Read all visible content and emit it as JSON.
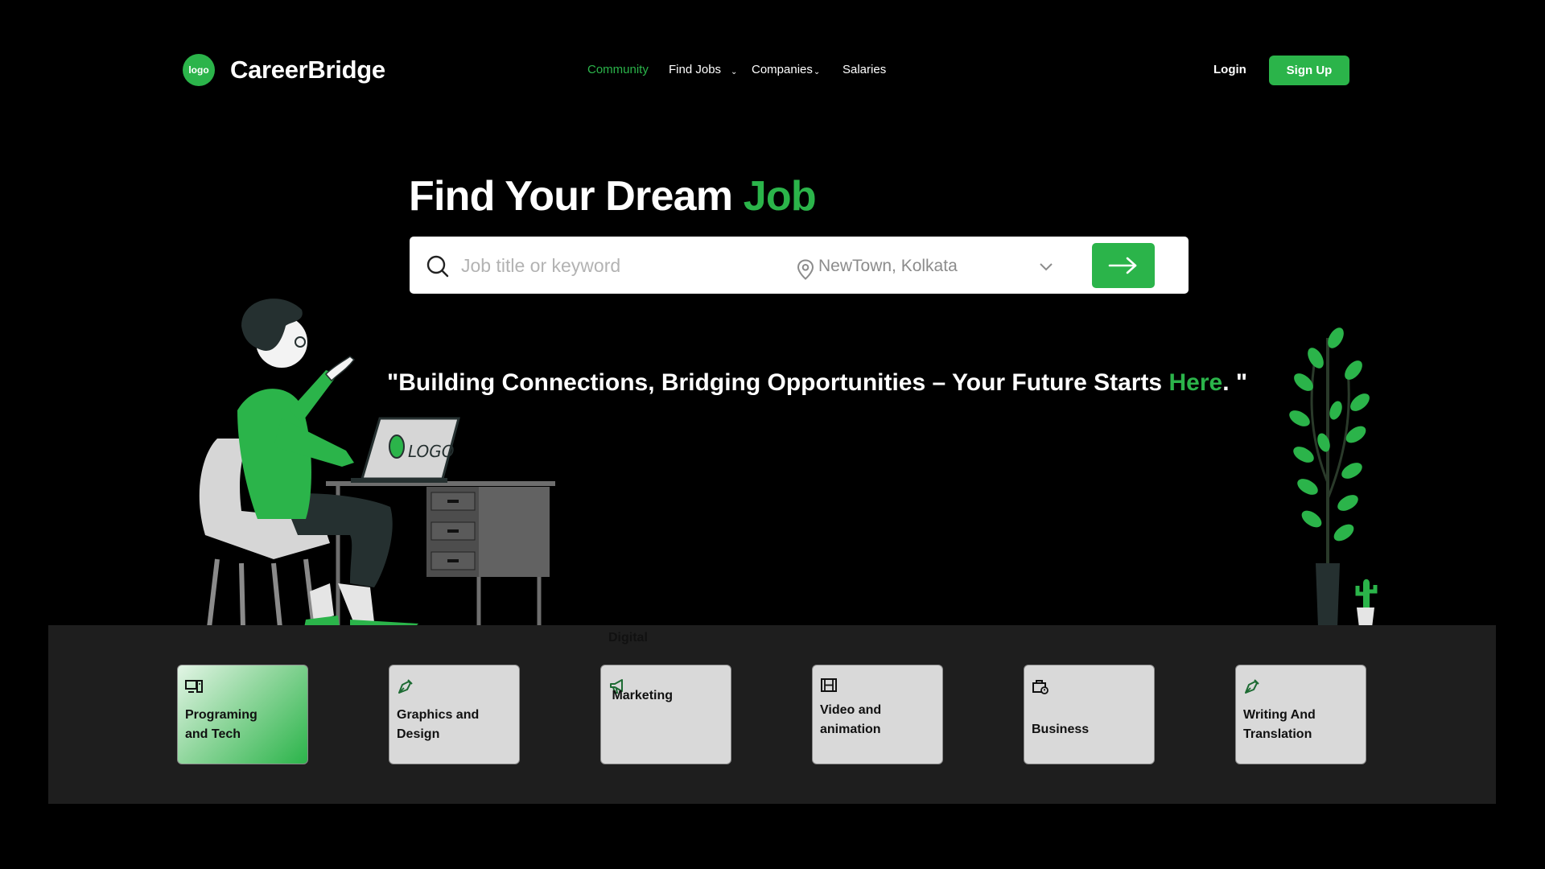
{
  "colors": {
    "accent": "#2bb44a",
    "background": "#000000",
    "band": "#1e1e1e",
    "card": "#d9d9d9"
  },
  "header": {
    "logo_badge": "logo",
    "brand": "CareerBridge",
    "nav": [
      {
        "label": "Community",
        "active": true
      },
      {
        "label": "Find Jobs",
        "has_dropdown": true
      },
      {
        "label": "Companies",
        "has_dropdown": true
      },
      {
        "label": "Salaries"
      }
    ],
    "login": "Login",
    "signup": "Sign Up"
  },
  "hero": {
    "title_main": "Find Your Dream ",
    "title_accent": "Job",
    "search": {
      "placeholder": "Job title or keyword",
      "location": "NewTown, Kolkata",
      "search_icon": "search-icon",
      "location_icon": "location-pin-icon",
      "dropdown_icon": "chevron-down-icon",
      "submit_icon": "arrow-right-icon"
    },
    "tagline_main": "\"Building Connections, Bridging Opportunities – Your Future Starts ",
    "tagline_accent": "Here",
    "tagline_end": ". \"",
    "illustration_text": "LOGO"
  },
  "categories": [
    {
      "label_line1": "Programing",
      "label_line2": "and Tech",
      "icon": "computer-icon",
      "active": true
    },
    {
      "label_line1": "Graphics and",
      "label_line2": "Design",
      "icon": "pen-nib-icon"
    },
    {
      "label_line1": "Digital",
      "label_line2": " Marketing",
      "icon": "megaphone-icon"
    },
    {
      "label_line1": "Video and",
      "label_line2": "animation",
      "icon": "film-icon"
    },
    {
      "label_line1": "Business",
      "label_line2": "",
      "icon": "briefcase-icon"
    },
    {
      "label_line1": "Writing And",
      "label_line2": "Translation",
      "icon": "pen-nib-icon"
    }
  ]
}
